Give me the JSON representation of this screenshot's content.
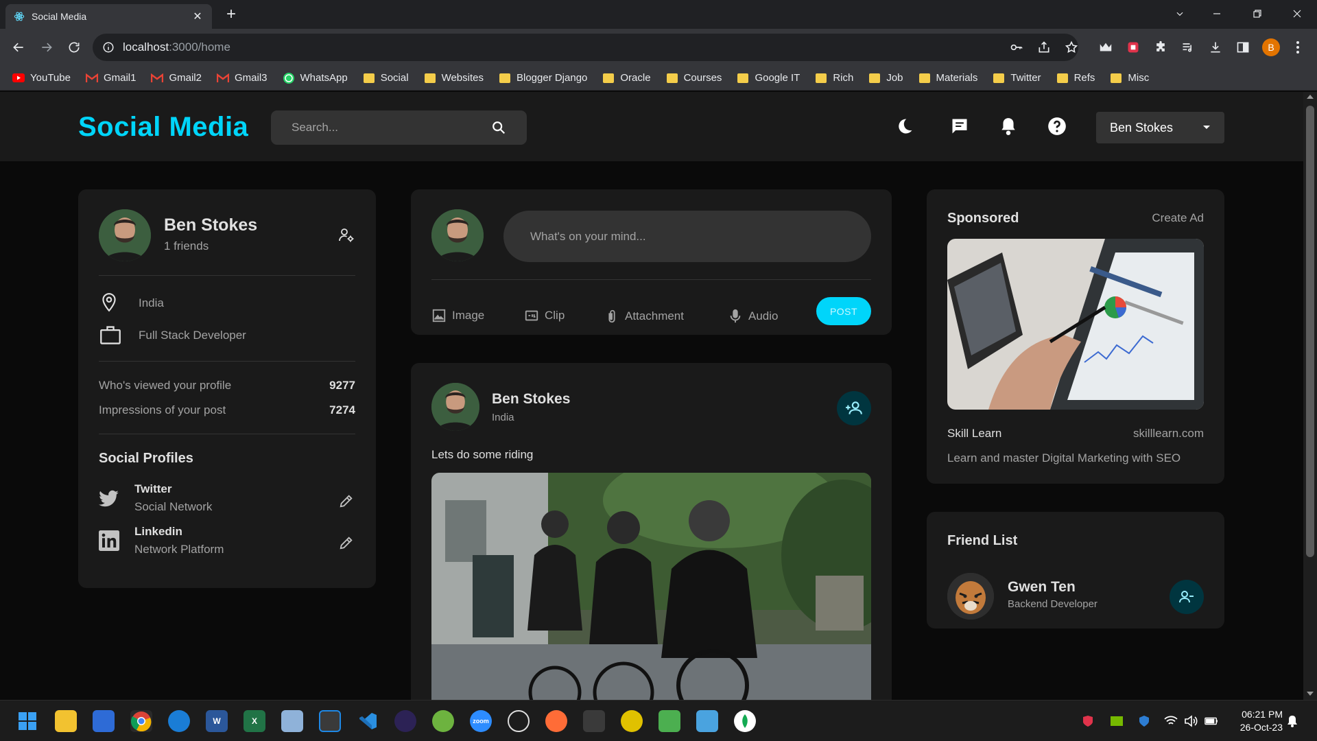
{
  "browser": {
    "tab_title": "Social Media",
    "url_host": "localhost",
    "url_path": ":3000/home",
    "profile_initial": "B",
    "bookmarks": [
      "YouTube",
      "Gmail1",
      "Gmail2",
      "Gmail3",
      "WhatsApp",
      "Social",
      "Websites",
      "Blogger Django",
      "Oracle",
      "Courses",
      "Google IT",
      "Rich",
      "Job",
      "Materials",
      "Twitter",
      "Refs",
      "Misc"
    ]
  },
  "navbar": {
    "logo": "Social Media",
    "search_placeholder": "Search...",
    "user_name": "Ben Stokes"
  },
  "profile": {
    "name": "Ben Stokes",
    "friends": "1 friends",
    "location": "India",
    "occupation": "Full Stack Developer",
    "viewed_label": "Who's viewed your profile",
    "viewed_value": "9277",
    "impressions_label": "Impressions of your post",
    "impressions_value": "7274",
    "social_title": "Social Profiles",
    "socials": [
      {
        "name": "Twitter",
        "type": "Social Network"
      },
      {
        "name": "Linkedin",
        "type": "Network Platform"
      }
    ]
  },
  "composer": {
    "placeholder": "What's on your mind...",
    "actions": [
      "Image",
      "Clip",
      "Attachment",
      "Audio"
    ],
    "post_label": "POST"
  },
  "post": {
    "author": "Ben Stokes",
    "location": "India",
    "text": "Lets do some riding"
  },
  "sponsored": {
    "title": "Sponsored",
    "create_ad": "Create Ad",
    "brand": "Skill Learn",
    "site": "skilllearn.com",
    "description": "Learn and master Digital Marketing with SEO"
  },
  "friends": {
    "title": "Friend List",
    "items": [
      {
        "name": "Gwen Ten",
        "role": "Backend Developer"
      }
    ]
  },
  "taskbar": {
    "time": "06:21 PM",
    "date": "26-Oct-23"
  },
  "colors": {
    "accent": "#00d5fa",
    "card": "#1a1a1a",
    "background": "#0a0a0a",
    "icon_button": "#00353f"
  }
}
